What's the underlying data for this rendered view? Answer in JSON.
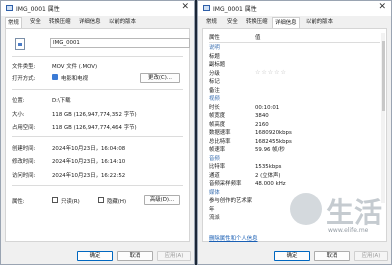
{
  "left_window": {
    "title": "IMG_0001 属性",
    "close_glyph": "✕",
    "tabs": [
      "常规",
      "安全",
      "转换压缩",
      "详细信息",
      "以前的版本"
    ],
    "active_tab": 0,
    "file_name": "IMG_0001",
    "rows": {
      "type_label": "文件类型:",
      "type_value": "MOV 文件 (.MOV)",
      "open_label": "打开方式:",
      "open_value": "电影和电视",
      "change_button": "更改(C)...",
      "location_label": "位置:",
      "location_value": "D:\\下载",
      "size_label": "大小:",
      "size_value": "118 GB (126,947,774,352 字节)",
      "disk_label": "占用空间:",
      "disk_value": "118 GB (126,947,774,464 字节)",
      "created_label": "创建时间:",
      "created_value": "2024年10月23日，16:04:08",
      "modified_label": "修改时间:",
      "modified_value": "2024年10月23日，16:14:10",
      "accessed_label": "访问时间:",
      "accessed_value": "2024年10月23日，16:22:52",
      "attr_label": "属性:",
      "readonly_label": "只读(R)",
      "hidden_label": "隐藏(H)",
      "advanced_button": "高级(D)..."
    },
    "buttons": {
      "ok": "确定",
      "cancel": "取消",
      "apply": "应用(A)"
    }
  },
  "right_window": {
    "title": "IMG_0001 属性",
    "close_glyph": "✕",
    "tabs": [
      "常规",
      "安全",
      "转换压缩",
      "详细信息",
      "以前的版本"
    ],
    "active_tab": 3,
    "header": {
      "property": "属性",
      "value": "值"
    },
    "rows": [
      {
        "p": "说明",
        "v": "",
        "section": true
      },
      {
        "p": "标题",
        "v": ""
      },
      {
        "p": "副标题",
        "v": ""
      },
      {
        "p": "分级",
        "v": "☆☆☆☆☆",
        "stars": true
      },
      {
        "p": "标记",
        "v": ""
      },
      {
        "p": "备注",
        "v": ""
      },
      {
        "p": "视频",
        "v": "",
        "section": true
      },
      {
        "p": "时长",
        "v": "00:10:01"
      },
      {
        "p": "帧宽度",
        "v": "3840"
      },
      {
        "p": "帧高度",
        "v": "2160"
      },
      {
        "p": "数据速率",
        "v": "1680920kbps"
      },
      {
        "p": "总比特率",
        "v": "1682455kbps"
      },
      {
        "p": "帧速率",
        "v": "59.96 帧/秒"
      },
      {
        "p": "音频",
        "v": "",
        "section": true
      },
      {
        "p": "比特率",
        "v": "1535kbps"
      },
      {
        "p": "通道",
        "v": "2 (立体声)"
      },
      {
        "p": "音频采样频率",
        "v": "48.000 kHz"
      },
      {
        "p": "媒体",
        "v": "",
        "section": true
      },
      {
        "p": "参与创作的艺术家",
        "v": ""
      },
      {
        "p": "年",
        "v": ""
      },
      {
        "p": "流派",
        "v": ""
      }
    ],
    "remove_link": "删除属性和个人信息",
    "buttons": {
      "ok": "确定",
      "cancel": "取消",
      "apply": "应用(A)"
    }
  },
  "watermark": {
    "text": "生活",
    "url": "www.elife.me"
  }
}
